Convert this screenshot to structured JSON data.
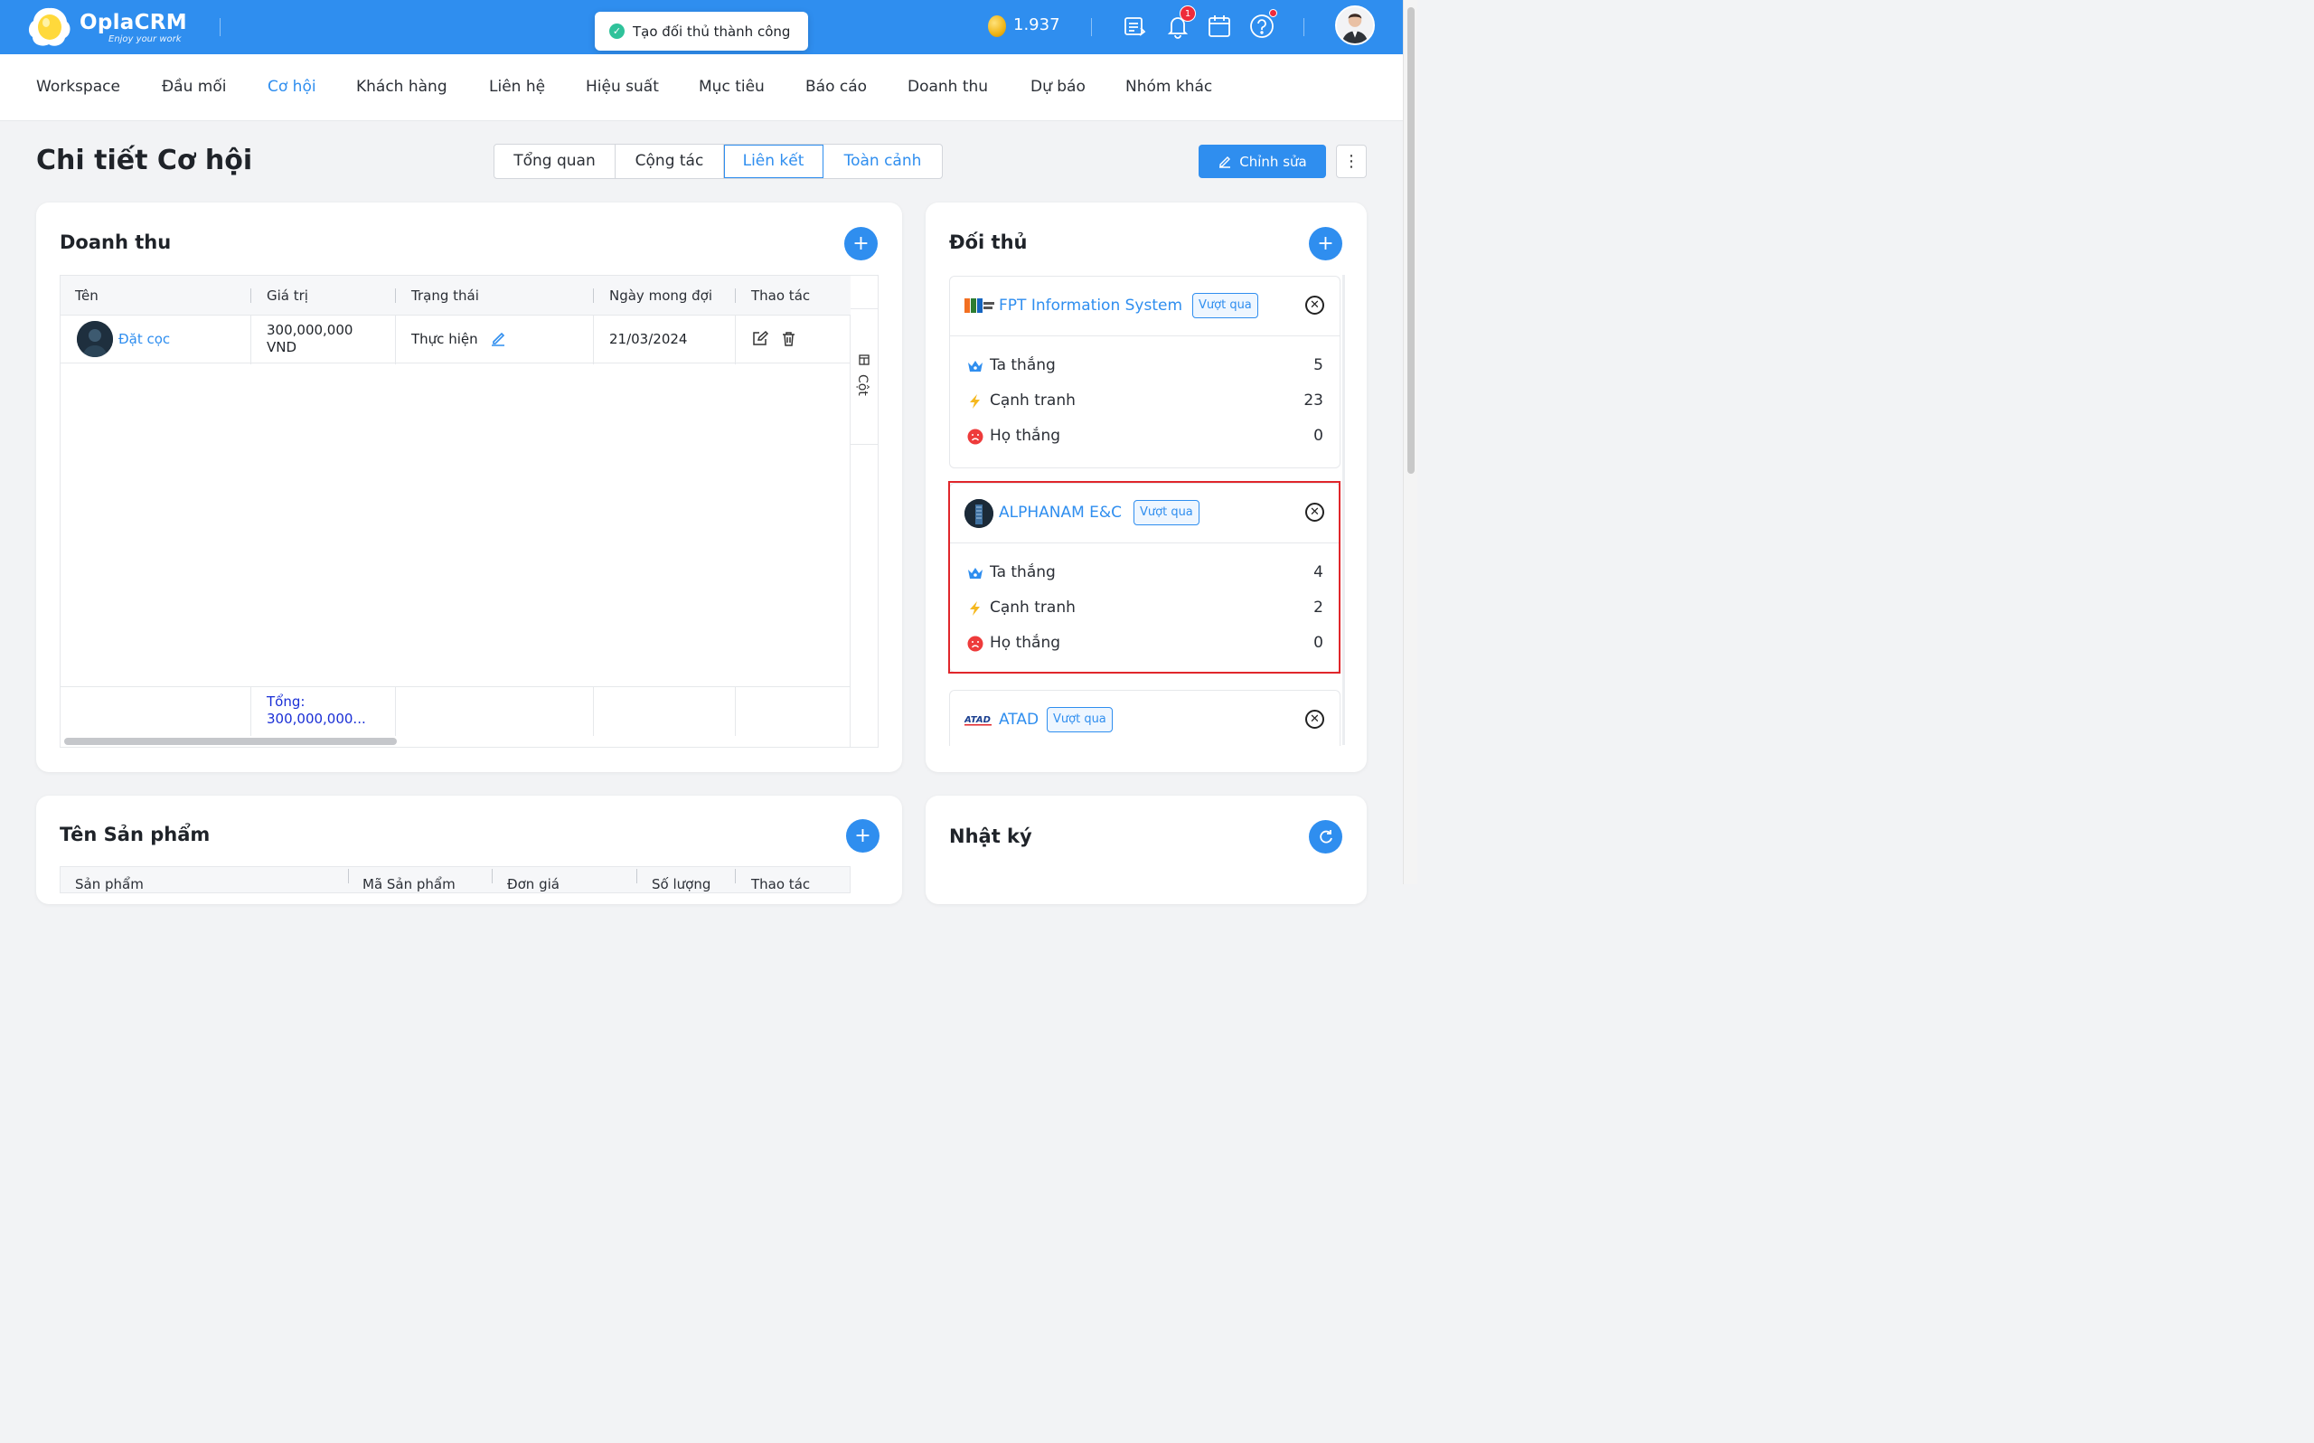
{
  "brand": {
    "name": "OplaCRM",
    "tagline": "Enjoy your work"
  },
  "toast": {
    "message": "Tạo đối thủ thành công"
  },
  "topbar": {
    "coins": "1.937",
    "notifications_count": "1"
  },
  "nav": {
    "items": [
      "Workspace",
      "Đầu mối",
      "Cơ hội",
      "Khách hàng",
      "Liên hệ",
      "Hiệu suất",
      "Mục tiêu",
      "Báo cáo",
      "Doanh thu",
      "Dự báo",
      "Nhóm khác"
    ],
    "active": "Cơ hội"
  },
  "page": {
    "title": "Chi tiết Cơ hội",
    "tabs": [
      "Tổng quan",
      "Cộng tác",
      "Liên kết",
      "Toàn cảnh"
    ],
    "active_tab": "Liên kết",
    "edit_label": "Chỉnh sửa"
  },
  "revenue": {
    "title": "Doanh thu",
    "columns": [
      "Tên",
      "Giá trị",
      "Trạng thái",
      "Ngày mong đợi",
      "Thao tác"
    ],
    "rows": [
      {
        "name": "Đặt cọc",
        "value_line1": "300,000,000",
        "value_line2": "VND",
        "status": "Thực hiện",
        "date": "21/03/2024"
      }
    ],
    "total_label": "Tổng:",
    "total_value": "300,000,000...",
    "columns_toggle": "Cột"
  },
  "competitors": {
    "title": "Đối thủ",
    "stat_labels": {
      "win": "Ta thắng",
      "compete": "Cạnh tranh",
      "lose": "Họ thắng"
    },
    "items": [
      {
        "name": "FPT Information System",
        "tag": "Vượt qua",
        "win": "5",
        "compete": "23",
        "lose": "0"
      },
      {
        "name": "ALPHANAM E&C",
        "tag": "Vượt qua",
        "win": "4",
        "compete": "2",
        "lose": "0"
      },
      {
        "name": "ATAD",
        "tag": "Vượt qua"
      }
    ]
  },
  "products": {
    "title": "Tên Sản phẩm",
    "columns": [
      "Sản phẩm",
      "Mã Sản phẩm",
      "Đơn giá",
      "Số lượng",
      "Thao tác"
    ]
  },
  "log": {
    "title": "Nhật ký"
  },
  "colors": {
    "primary": "#2f8eef",
    "highlight": "#e0262b",
    "lose": "#ee3b3b",
    "compete": "#f5b81f"
  }
}
